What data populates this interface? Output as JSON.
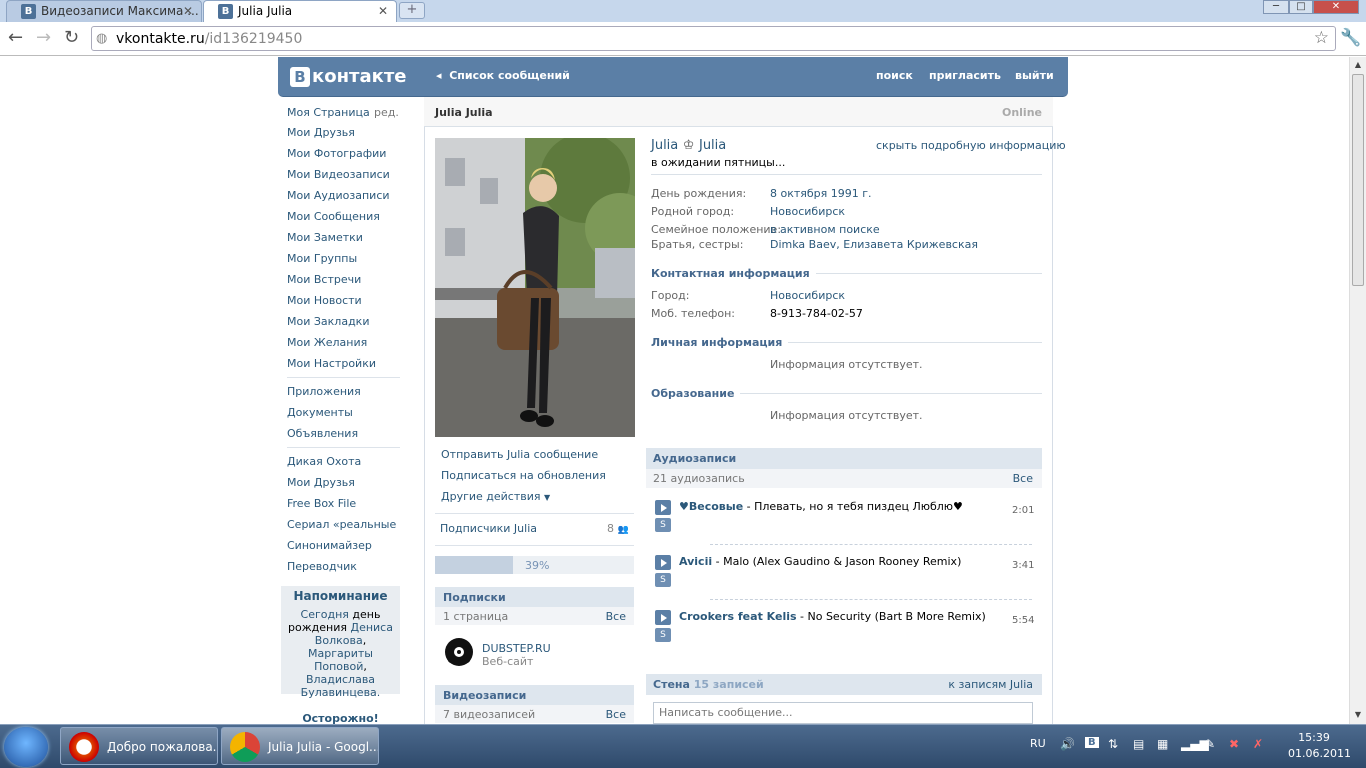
{
  "browser": {
    "tabs": [
      {
        "label": "Видеозаписи Максима ..."
      },
      {
        "label": "Julia Julia"
      }
    ],
    "url_domain": "vkontakte.ru",
    "url_path": "/id136219450"
  },
  "header": {
    "logo": "контакте",
    "logo_letter": "В",
    "back_label": "Список сообщений",
    "links": [
      "поиск",
      "пригласить",
      "выйти"
    ]
  },
  "sidebar": {
    "edit": "ред.",
    "group1": [
      "Моя Страница",
      "Мои Друзья",
      "Мои Фотографии",
      "Мои Видеозаписи",
      "Мои Аудиозаписи",
      "Мои Сообщения",
      "Мои Заметки",
      "Мои Группы",
      "Мои Встречи",
      "Мои Новости",
      "Мои Закладки",
      "Мои Желания",
      "Мои Настройки"
    ],
    "group2": [
      "Приложения",
      "Документы",
      "Объявления"
    ],
    "group3": [
      "Дикая Охота",
      "Мои Друзья",
      "Free Box File",
      "Сериал «реальные",
      "Синонимайзер",
      "Переводчик"
    ],
    "reminder": {
      "title": "Напоминание",
      "today": "Сегодня",
      "bday": "день рождения",
      "p1": "Дениса Волкова",
      "p2": "Маргариты Поповой",
      "p3": "Владислава Булавинцева."
    },
    "warning": "Осторожно!"
  },
  "profile": {
    "page_title": "Julia Julia",
    "online": "Online",
    "first_name": "Julia",
    "last_name": "Julia",
    "crown": "♔",
    "hide_info": "скрыть подробную информацию",
    "status": "в ожидании пятницы...",
    "fields": [
      {
        "label": "День рождения:",
        "value": "8 октября 1991 г."
      },
      {
        "label": "Родной город:",
        "value": "Новосибирск"
      },
      {
        "label": "Семейное положение:",
        "value": "в активном поиске"
      },
      {
        "label": "Братья, сестры:",
        "value": "Dimka Baev, Елизавета Крижевская"
      }
    ],
    "contact_head": "Контактная информация",
    "contact": [
      {
        "label": "Город:",
        "value": "Новосибирск"
      },
      {
        "label": "Моб. телефон:",
        "value": "8-913-784-02-57"
      }
    ],
    "personal_head": "Личная информация",
    "personal_empty": "Информация отсутствует.",
    "edu_head": "Образование",
    "edu_empty": "Информация отсутствует."
  },
  "actions": {
    "send": "Отправить Julia сообщение",
    "subscribe": "Подписаться на обновления",
    "other": "Другие действия",
    "followers": "Подписчики Julia",
    "followers_count": "8"
  },
  "rating": {
    "label": "39%",
    "fraction": 0.39
  },
  "subscriptions": {
    "head": "Подписки",
    "count": "1 страница",
    "all": "Все",
    "item_name": "DUBSTEP.RU",
    "item_type": "Веб-сайт"
  },
  "videos": {
    "head": "Видеозаписи",
    "count": "7 видеозаписей",
    "all": "Все"
  },
  "audio": {
    "head": "Аудиозаписи",
    "count": "21 аудиозапись",
    "all": "Все",
    "s_label": "S",
    "tracks": [
      {
        "artist": "♥Весовые",
        "title": " - Плевать, но я тебя пиздец Люблю♥",
        "duration": "2:01"
      },
      {
        "artist": "Avicii",
        "title": " - Malo (Alex Gaudino & Jason Rooney Remix)",
        "duration": "3:41"
      },
      {
        "artist": "Crookers feat Kelis",
        "title": " - No Security (Bart B More Remix)",
        "duration": "5:54"
      }
    ]
  },
  "wall": {
    "head": "Стена",
    "count": "15 записей",
    "to_wall": "к записям Julia",
    "placeholder": "Написать сообщение..."
  },
  "taskbar": {
    "items": [
      "Добро пожалова...",
      "Julia Julia - Googl..."
    ],
    "lang": "RU",
    "time": "15:39",
    "date": "01.06.2011"
  }
}
